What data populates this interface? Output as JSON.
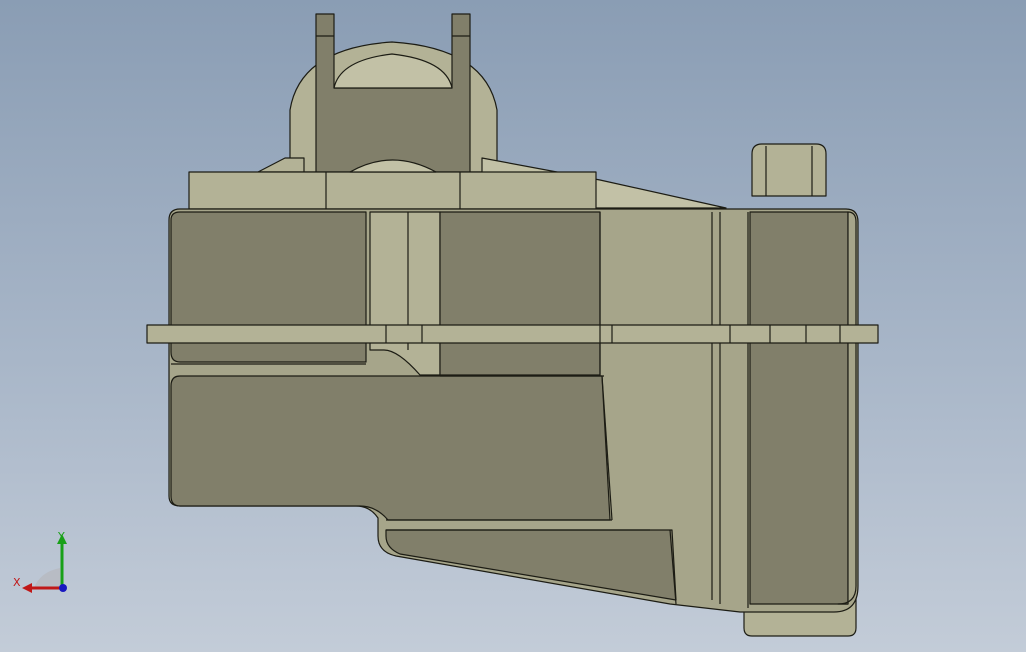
{
  "viewport": {
    "background_top": "#8a9db4",
    "background_bottom": "#c3ccd8"
  },
  "model": {
    "face_light": "#b3b296",
    "face_mid": "#a6a58a",
    "face_dark": "#817f6a",
    "edge_color": "#1c1c14"
  },
  "triad": {
    "x_label": "X",
    "y_label": "Y",
    "x_color": "#c01818",
    "y_color": "#18a018",
    "z_color": "#1818c0"
  }
}
